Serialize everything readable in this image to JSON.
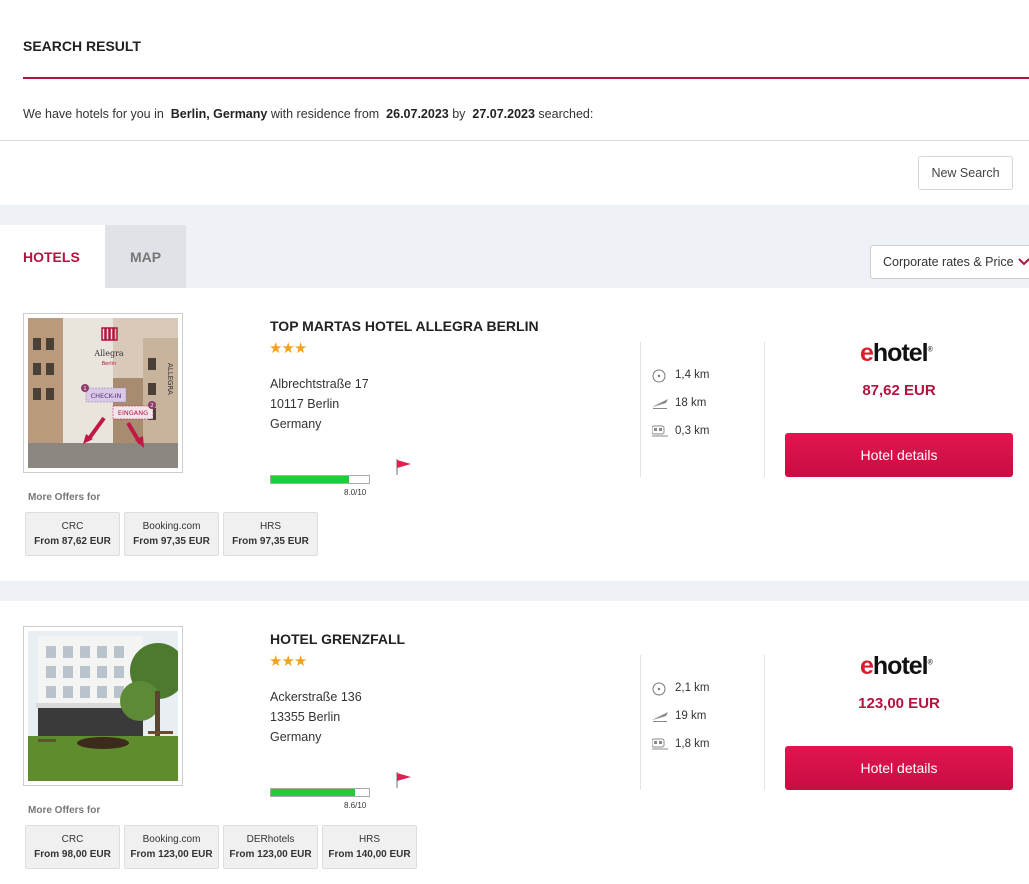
{
  "header": {
    "title": "SEARCH RESULT",
    "summary_prefix": "We have hotels for you in",
    "location": "Berlin, Germany",
    "summary_mid": "with residence from",
    "date_from": "26.07.2023",
    "summary_by": "by",
    "date_to": "27.07.2023",
    "summary_suffix": "searched:",
    "new_search_label": "New Search"
  },
  "tabs": [
    {
      "label": "HOTELS",
      "active": true
    },
    {
      "label": "MAP",
      "active": false
    }
  ],
  "sort": {
    "selected": "Corporate rates & Price"
  },
  "colors": {
    "accent": "#b5123e",
    "button": "#d81048",
    "star": "#f4a21a",
    "rating": "#1fcc3a"
  },
  "hotels": [
    {
      "name": "TOP MARTAS HOTEL ALLEGRA BERLIN",
      "stars": "★★★",
      "star_count": 3,
      "address": [
        "Albrechtstraße 17",
        "10117 Berlin",
        "Germany"
      ],
      "rating_text": "8.0/10",
      "rating_value": 8.0,
      "distances": [
        {
          "icon": "city-center-icon",
          "value": "1,4 km"
        },
        {
          "icon": "airport-icon",
          "value": "18 km"
        },
        {
          "icon": "train-icon",
          "value": "0,3 km"
        }
      ],
      "provider_logo": {
        "e": "e",
        "rest": "hotel",
        "mark": "®"
      },
      "price": "87,62 EUR",
      "details_label": "Hotel details",
      "photo_labels": {
        "brand": "Allegra",
        "city": "Berlin",
        "checkin": "CHECK-IN",
        "entrance": "EINGANG",
        "facade": "ALLEGRA",
        "step1": "1",
        "step2": "2"
      },
      "more_offers_label": "More Offers for",
      "offers": [
        {
          "name": "CRC",
          "price": "From 87,62 EUR"
        },
        {
          "name": "Booking.com",
          "price": "From 97,35 EUR"
        },
        {
          "name": "HRS",
          "price": "From 97,35 EUR"
        }
      ]
    },
    {
      "name": "HOTEL GRENZFALL",
      "stars": "★★★",
      "star_count": 3,
      "address": [
        "Ackerstraße 136",
        "13355 Berlin",
        "Germany"
      ],
      "rating_text": "8.6/10",
      "rating_value": 8.6,
      "distances": [
        {
          "icon": "city-center-icon",
          "value": "2,1 km"
        },
        {
          "icon": "airport-icon",
          "value": "19 km"
        },
        {
          "icon": "train-icon",
          "value": "1,8 km"
        }
      ],
      "provider_logo": {
        "e": "e",
        "rest": "hotel",
        "mark": "®"
      },
      "price": "123,00 EUR",
      "details_label": "Hotel details",
      "more_offers_label": "More Offers for",
      "offers": [
        {
          "name": "CRC",
          "price": "From 98,00 EUR"
        },
        {
          "name": "Booking.com",
          "price": "From 123,00 EUR"
        },
        {
          "name": "DERhotels",
          "price": "From 123,00 EUR"
        },
        {
          "name": "HRS",
          "price": "From 140,00 EUR"
        }
      ]
    }
  ]
}
